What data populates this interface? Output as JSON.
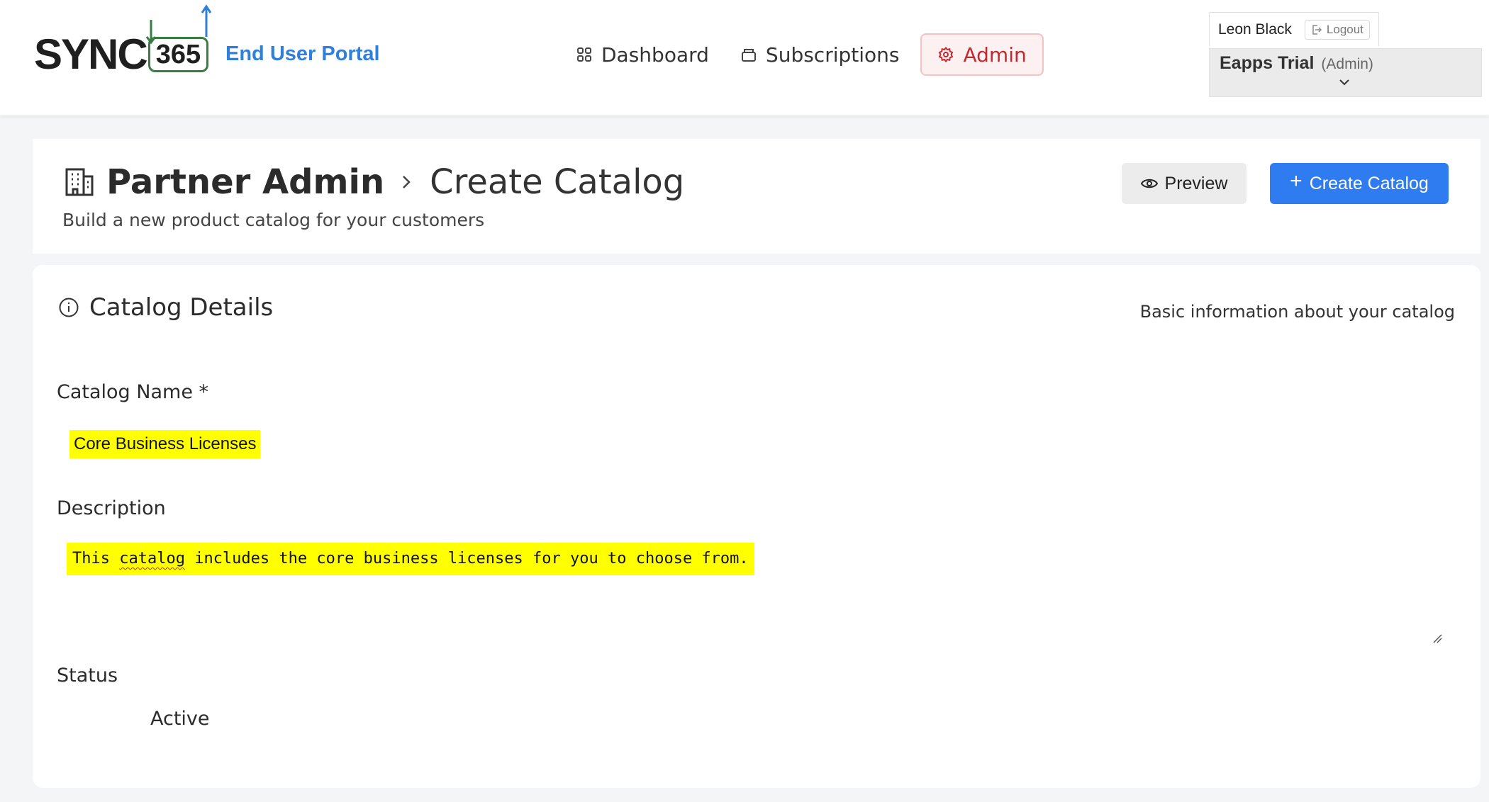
{
  "header": {
    "logo": {
      "word": "SYNC",
      "number": "365"
    },
    "portal_title": "End User Portal",
    "nav": [
      {
        "label": "Dashboard",
        "icon": "grid-icon"
      },
      {
        "label": "Subscriptions",
        "icon": "box-icon"
      },
      {
        "label": "Admin",
        "icon": "gear-icon",
        "active": true
      }
    ],
    "user": {
      "name": "Leon Black",
      "logout_label": "Logout"
    },
    "tenant": {
      "name": "Eapps Trial",
      "role": "(Admin)"
    }
  },
  "page": {
    "breadcrumb_root": "Partner Admin",
    "breadcrumb_current": "Create Catalog",
    "subtitle": "Build a new product catalog for your customers",
    "preview_label": "Preview",
    "create_label": "Create Catalog"
  },
  "details": {
    "section_title": "Catalog Details",
    "section_hint": "Basic information about your catalog",
    "name_label": "Catalog Name *",
    "name_value": "Core Business Licenses",
    "description_label": "Description",
    "description_parts": {
      "before": "This ",
      "misspelled": "catalog",
      "after": " includes the core business licenses for you to choose from."
    },
    "status_label": "Status",
    "status_value": "Active"
  },
  "colors": {
    "accent_blue": "#2f7cf0",
    "portal_blue": "#2f7fdb",
    "admin_red": "#c2292e",
    "highlight": "#ffff00",
    "logo_green": "#3a7d44"
  }
}
